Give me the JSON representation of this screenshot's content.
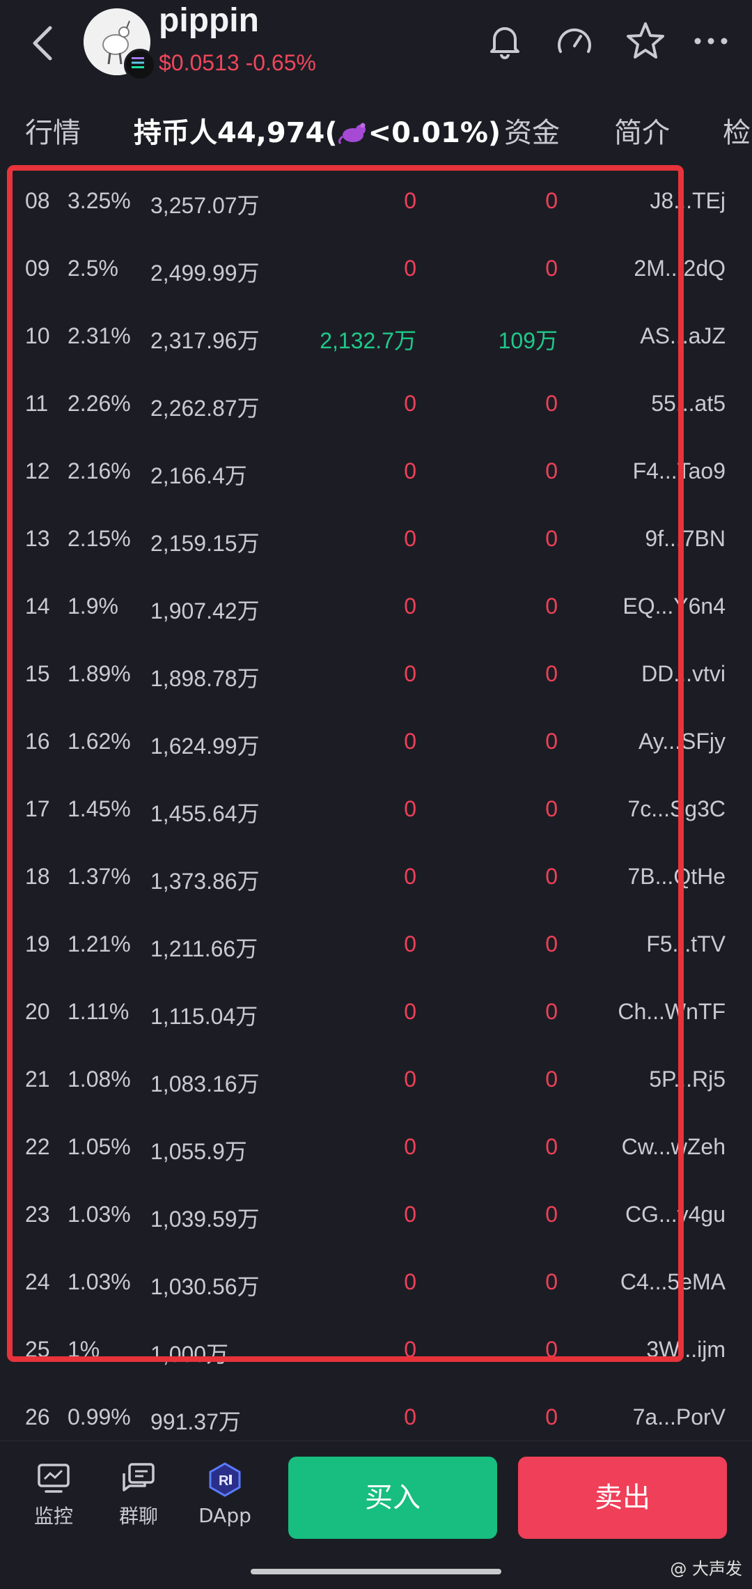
{
  "header": {
    "token_name": "pippin",
    "price_change": "$0.0513 -0.65%",
    "icons": [
      "back-icon",
      "bell-icon",
      "speedometer-icon",
      "star-icon",
      "more-icon"
    ]
  },
  "tabs": {
    "market": "行情",
    "holders": "持币人44,974(",
    "holders_suffix": "<0.01%)",
    "funds": "资金",
    "intro": "简介",
    "check": "检"
  },
  "rows": [
    {
      "rank": "08",
      "pct": "3.25%",
      "amount": "3,257.07万",
      "buy": "0",
      "sell": "0",
      "addr": "J8...TEj"
    },
    {
      "rank": "09",
      "pct": "2.5%",
      "amount": "2,499.99万",
      "buy": "0",
      "sell": "0",
      "addr": "2M...2dQ"
    },
    {
      "rank": "10",
      "pct": "2.31%",
      "amount": "2,317.96万",
      "buy": "2,132.7万",
      "sell": "109万",
      "addr": "AS...aJZ"
    },
    {
      "rank": "11",
      "pct": "2.26%",
      "amount": "2,262.87万",
      "buy": "0",
      "sell": "0",
      "addr": "55...at5"
    },
    {
      "rank": "12",
      "pct": "2.16%",
      "amount": "2,166.4万",
      "buy": "0",
      "sell": "0",
      "addr": "F4...Tao9"
    },
    {
      "rank": "13",
      "pct": "2.15%",
      "amount": "2,159.15万",
      "buy": "0",
      "sell": "0",
      "addr": "9f...7BN"
    },
    {
      "rank": "14",
      "pct": "1.9%",
      "amount": "1,907.42万",
      "buy": "0",
      "sell": "0",
      "addr": "EQ...Y6n4"
    },
    {
      "rank": "15",
      "pct": "1.89%",
      "amount": "1,898.78万",
      "buy": "0",
      "sell": "0",
      "addr": "DD...vtvi"
    },
    {
      "rank": "16",
      "pct": "1.62%",
      "amount": "1,624.99万",
      "buy": "0",
      "sell": "0",
      "addr": "Ay...SFjy"
    },
    {
      "rank": "17",
      "pct": "1.45%",
      "amount": "1,455.64万",
      "buy": "0",
      "sell": "0",
      "addr": "7c...Sg3C"
    },
    {
      "rank": "18",
      "pct": "1.37%",
      "amount": "1,373.86万",
      "buy": "0",
      "sell": "0",
      "addr": "7B...QtHe"
    },
    {
      "rank": "19",
      "pct": "1.21%",
      "amount": "1,211.66万",
      "buy": "0",
      "sell": "0",
      "addr": "F5...tTV"
    },
    {
      "rank": "20",
      "pct": "1.11%",
      "amount": "1,115.04万",
      "buy": "0",
      "sell": "0",
      "addr": "Ch...WnTF"
    },
    {
      "rank": "21",
      "pct": "1.08%",
      "amount": "1,083.16万",
      "buy": "0",
      "sell": "0",
      "addr": "5P...Rj5"
    },
    {
      "rank": "22",
      "pct": "1.05%",
      "amount": "1,055.9万",
      "buy": "0",
      "sell": "0",
      "addr": "Cw...wZeh"
    },
    {
      "rank": "23",
      "pct": "1.03%",
      "amount": "1,039.59万",
      "buy": "0",
      "sell": "0",
      "addr": "CG...v4gu"
    },
    {
      "rank": "24",
      "pct": "1.03%",
      "amount": "1,030.56万",
      "buy": "0",
      "sell": "0",
      "addr": "C4...5eMA"
    },
    {
      "rank": "25",
      "pct": "1%",
      "amount": "1,000万",
      "buy": "0",
      "sell": "0",
      "addr": "3W...ijm"
    },
    {
      "rank": "26",
      "pct": "0.99%",
      "amount": "991.37万",
      "buy": "0",
      "sell": "0",
      "addr": "7a...PorV"
    }
  ],
  "bottom_nav": {
    "monitor": "监控",
    "group_chat": "群聊",
    "dapp": "DApp",
    "buy": "买入",
    "sell": "卖出"
  },
  "watermark": "@ 大声发",
  "colors": {
    "background": "#1c1d24",
    "price_red": "#f0465c",
    "zero_red": "#ef4058",
    "value_green": "#1fc98a",
    "buy_button": "#17be7f",
    "sell_button": "#f03f58",
    "highlight_box": "#e8333b"
  }
}
